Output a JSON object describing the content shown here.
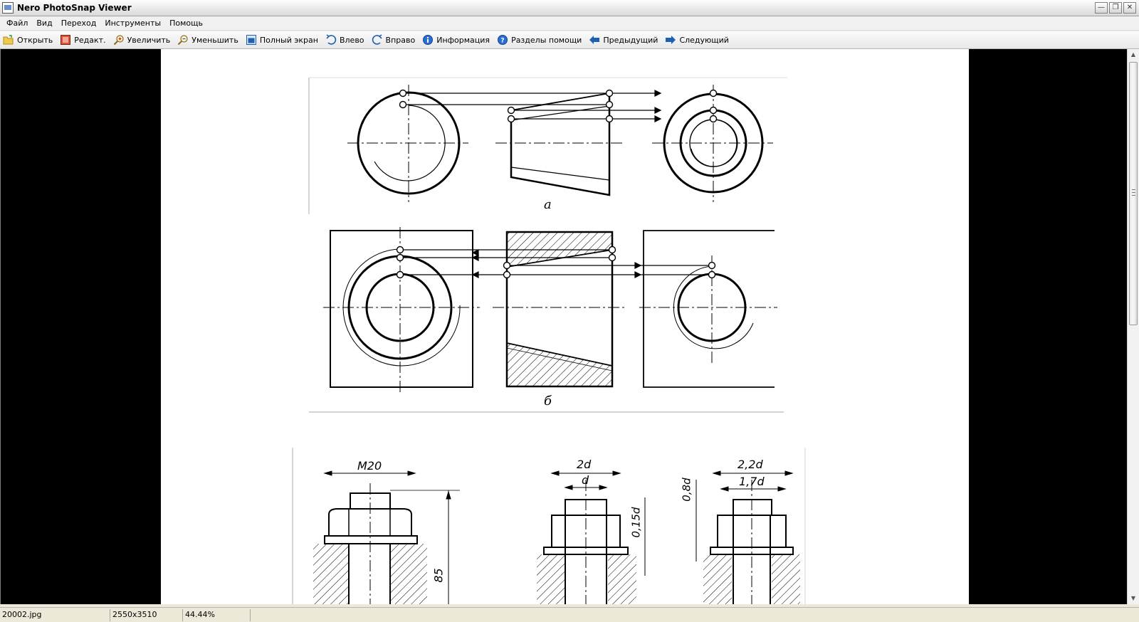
{
  "window": {
    "title": "Nero PhotoSnap Viewer",
    "buttons": [
      "minimize",
      "restore",
      "close"
    ]
  },
  "menu": [
    {
      "label": "Файл"
    },
    {
      "label": "Вид"
    },
    {
      "label": "Переход"
    },
    {
      "label": "Инструменты"
    },
    {
      "label": "Помощь"
    }
  ],
  "toolbar": [
    {
      "label": "Открыть",
      "icon": "folder-open-icon"
    },
    {
      "label": "Редакт.",
      "icon": "edit-image-icon"
    },
    {
      "label": "Увеличить",
      "icon": "zoom-in-icon"
    },
    {
      "label": "Уменьшить",
      "icon": "zoom-out-icon"
    },
    {
      "label": "Полный экран",
      "icon": "fullscreen-icon"
    },
    {
      "label": "Влево",
      "icon": "rotate-left-icon"
    },
    {
      "label": "Вправо",
      "icon": "rotate-right-icon"
    },
    {
      "label": "Информация",
      "icon": "info-icon"
    },
    {
      "label": "Разделы помощи",
      "icon": "help-icon"
    },
    {
      "label": "Предыдущий",
      "icon": "arrow-left-icon"
    },
    {
      "label": "Следующий",
      "icon": "arrow-right-icon"
    }
  ],
  "drawing": {
    "label_a": "а",
    "label_b": "б",
    "dim_m20": "M20",
    "dim_85": "85",
    "dim_2d": "2d",
    "dim_d": "d",
    "dim_015d": "0,15d",
    "dim_22d": "2,2d",
    "dim_17d": "1,7d",
    "dim_08d": "0,8d"
  },
  "status": {
    "filename": "20002.jpg",
    "dimensions": "2550x3510",
    "zoom": "44.44%"
  },
  "colors": {
    "accent_blue": "#1e5fb4",
    "toolbar_bg": "#efefef"
  }
}
